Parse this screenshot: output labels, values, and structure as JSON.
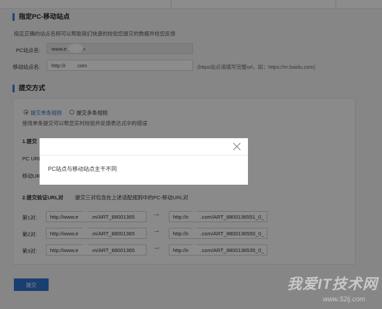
{
  "section_site": {
    "title": "指定PC-移动站点",
    "desc": "指定正确的站点名称可以帮助我们快速的校验您提交的数据并给您反馈",
    "pc_label": "PC站点名:",
    "pc_value": "www.e        na.com",
    "mobile_label": "移动站点名:",
    "mobile_value": "http://m        cn.com",
    "mobile_hint": "(https站点请填写完整url，如：https://m.baidu.com)"
  },
  "section_submit": {
    "title": "提交方式",
    "radio_single": "提交单条规则",
    "radio_multi": "提交多条规则",
    "radio_desc": "使用单条提交可以帮您实时校验并反馈表达式中的错误",
    "step1_label": "1.提交",
    "step1_tail": "",
    "pc_url_label": "PC URL",
    "mobile_url_label": "移动URL",
    "step2_label": "2.提交验证URL对",
    "step2_desc": "提交三对包含在上述适配规则中的PC-移动URL对",
    "pairs": [
      {
        "label": "第1对:",
        "pc": "http://www.e         na.com/ART_88001365",
        "mobile": "http://m.        -cn.com/ART_8800136551_0_"
      },
      {
        "label": "第2对:",
        "pc": "http://www.e         na.com/ART_88001365",
        "mobile": "http://m.        -cn.com/ART_8800136550_0_"
      },
      {
        "label": "第3对:",
        "pc": "http://www.e         na.com/ART_88001365",
        "mobile": "http://m.        -cn.com/ART_8800136535_0_"
      }
    ],
    "submit_label": "提交"
  },
  "modal": {
    "message": "PC站点与移动站点主干不同",
    "close_icon": "close-icon"
  },
  "watermark": {
    "main": "我爱IT技术网",
    "url": "www.52ij.com"
  },
  "colors": {
    "accent": "#2f74cf",
    "overlay": "rgba(0,0,0,0.45)"
  }
}
